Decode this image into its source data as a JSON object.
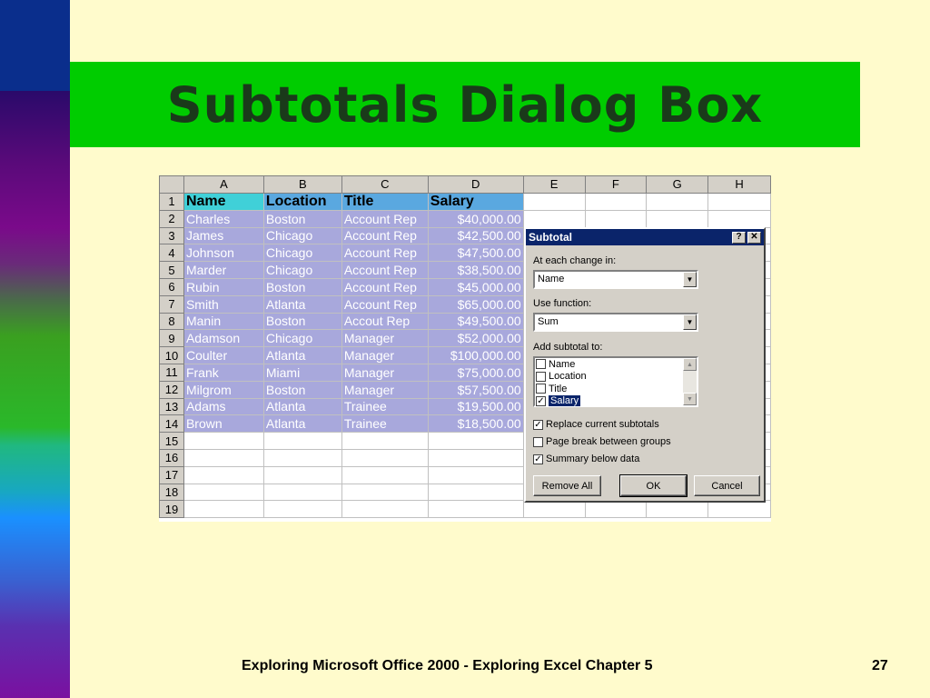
{
  "slide": {
    "title": "Subtotals Dialog Box",
    "footer": "Exploring Microsoft Office 2000 - Exploring Excel Chapter 5",
    "page_number": "27"
  },
  "sheet": {
    "columns": [
      "A",
      "B",
      "C",
      "D",
      "E",
      "F",
      "G",
      "H"
    ],
    "headers": [
      "Name",
      "Location",
      "Title",
      "Salary"
    ],
    "rows": [
      [
        "Charles",
        "Boston",
        "Account Rep",
        "$40,000.00"
      ],
      [
        "James",
        "Chicago",
        "Account Rep",
        "$42,500.00"
      ],
      [
        "Johnson",
        "Chicago",
        "Account Rep",
        "$47,500.00"
      ],
      [
        "Marder",
        "Chicago",
        "Account Rep",
        "$38,500.00"
      ],
      [
        "Rubin",
        "Boston",
        "Account Rep",
        "$45,000.00"
      ],
      [
        "Smith",
        "Atlanta",
        "Account Rep",
        "$65,000.00"
      ],
      [
        "Manin",
        "Boston",
        "Accout Rep",
        "$49,500.00"
      ],
      [
        "Adamson",
        "Chicago",
        "Manager",
        "$52,000.00"
      ],
      [
        "Coulter",
        "Atlanta",
        "Manager",
        "$100,000.00"
      ],
      [
        "Frank",
        "Miami",
        "Manager",
        "$75,000.00"
      ],
      [
        "Milgrom",
        "Boston",
        "Manager",
        "$57,500.00"
      ],
      [
        "Adams",
        "Atlanta",
        "Trainee",
        "$19,500.00"
      ],
      [
        "Brown",
        "Atlanta",
        "Trainee",
        "$18,500.00"
      ]
    ],
    "row_numbers": [
      "1",
      "2",
      "3",
      "4",
      "5",
      "6",
      "7",
      "8",
      "9",
      "10",
      "11",
      "12",
      "13",
      "14",
      "15",
      "16",
      "17",
      "18",
      "19"
    ]
  },
  "dialog": {
    "title": "Subtotal",
    "help_btn": "?",
    "close_btn": "✕",
    "at_each_change_label": "At each change in:",
    "at_each_change_value": "Name",
    "use_function_label": "Use function:",
    "use_function_value": "Sum",
    "add_subtotal_label": "Add subtotal to:",
    "subtotal_fields": [
      {
        "label": "Name",
        "checked": false
      },
      {
        "label": "Location",
        "checked": false
      },
      {
        "label": "Title",
        "checked": false
      },
      {
        "label": "Salary",
        "checked": true
      }
    ],
    "replace_label": "Replace current subtotals",
    "replace_checked": true,
    "page_break_label": "Page break between groups",
    "page_break_checked": false,
    "summary_label": "Summary below data",
    "summary_checked": true,
    "remove_all": "Remove All",
    "ok": "OK",
    "cancel": "Cancel"
  }
}
